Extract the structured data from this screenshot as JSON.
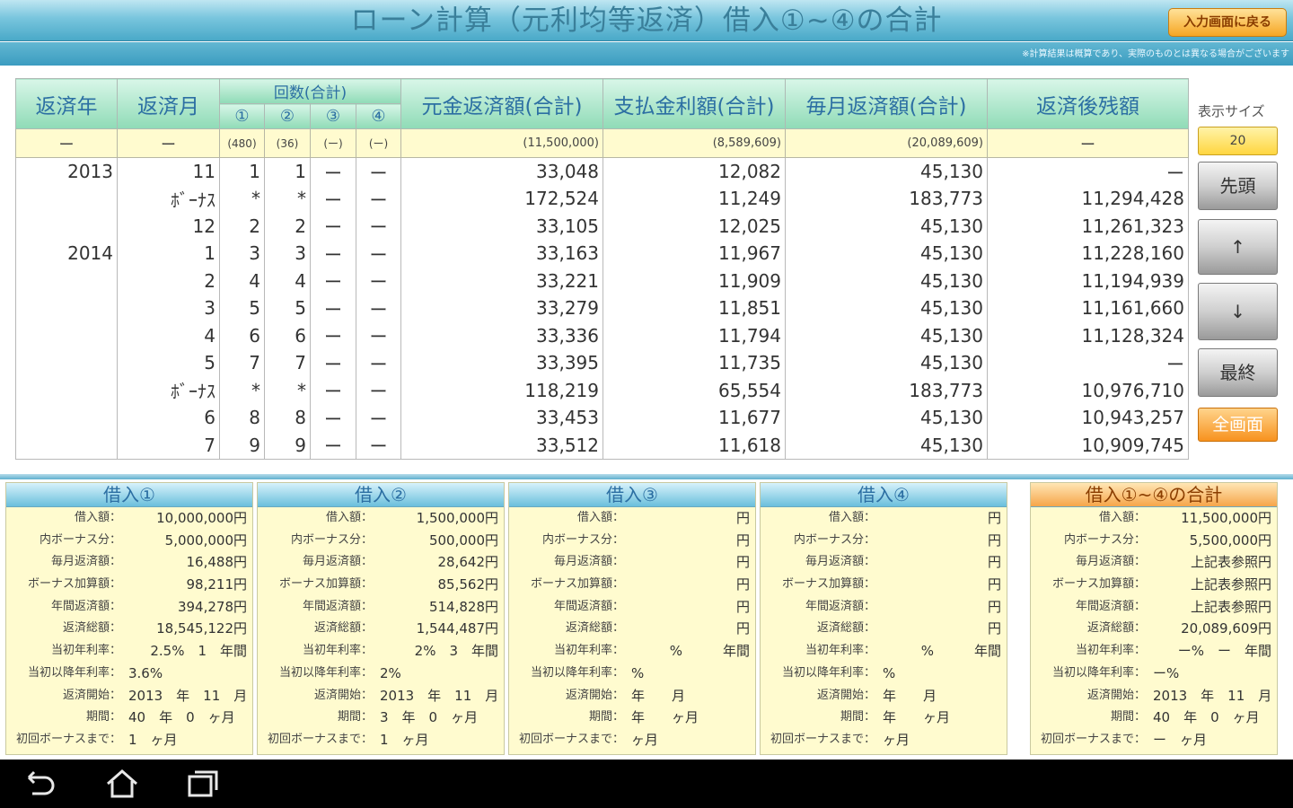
{
  "title": "ローン計算（元利均等返済）借入①~④の合計",
  "back_button": "入力画面に戻る",
  "note": "※計算結果は概算であり、実際のものとは異なる場合がございます",
  "table": {
    "headers": {
      "year": "返済年",
      "month": "返済月",
      "count": "回数(合計)",
      "count_sub": [
        "①",
        "②",
        "③",
        "④"
      ],
      "principal": "元金返済額(合計)",
      "interest": "支払金利額(合計)",
      "monthly": "毎月返済額(合計)",
      "balance": "返済後残額"
    },
    "totals": {
      "year": "ー",
      "month": "ー",
      "c1": "(480)",
      "c2": "(36)",
      "c3": "(ー)",
      "c4": "(ー)",
      "principal": "(11,500,000)",
      "interest": "(8,589,609)",
      "monthly": "(20,089,609)",
      "balance": "ー"
    },
    "rows": [
      {
        "year": "2013",
        "month": "11",
        "c1": "1",
        "c2": "1",
        "c3": "ー",
        "c4": "ー",
        "principal": "33,048",
        "interest": "12,082",
        "monthly": "45,130",
        "balance": "ー"
      },
      {
        "year": "",
        "month": "ﾎﾞｰﾅｽ",
        "c1": "*",
        "c2": "*",
        "c3": "ー",
        "c4": "ー",
        "principal": "172,524",
        "interest": "11,249",
        "monthly": "183,773",
        "balance": "11,294,428"
      },
      {
        "year": "",
        "month": "12",
        "c1": "2",
        "c2": "2",
        "c3": "ー",
        "c4": "ー",
        "principal": "33,105",
        "interest": "12,025",
        "monthly": "45,130",
        "balance": "11,261,323"
      },
      {
        "year": "2014",
        "month": "1",
        "c1": "3",
        "c2": "3",
        "c3": "ー",
        "c4": "ー",
        "principal": "33,163",
        "interest": "11,967",
        "monthly": "45,130",
        "balance": "11,228,160"
      },
      {
        "year": "",
        "month": "2",
        "c1": "4",
        "c2": "4",
        "c3": "ー",
        "c4": "ー",
        "principal": "33,221",
        "interest": "11,909",
        "monthly": "45,130",
        "balance": "11,194,939"
      },
      {
        "year": "",
        "month": "3",
        "c1": "5",
        "c2": "5",
        "c3": "ー",
        "c4": "ー",
        "principal": "33,279",
        "interest": "11,851",
        "monthly": "45,130",
        "balance": "11,161,660"
      },
      {
        "year": "",
        "month": "4",
        "c1": "6",
        "c2": "6",
        "c3": "ー",
        "c4": "ー",
        "principal": "33,336",
        "interest": "11,794",
        "monthly": "45,130",
        "balance": "11,128,324"
      },
      {
        "year": "",
        "month": "5",
        "c1": "7",
        "c2": "7",
        "c3": "ー",
        "c4": "ー",
        "principal": "33,395",
        "interest": "11,735",
        "monthly": "45,130",
        "balance": "ー"
      },
      {
        "year": "",
        "month": "ﾎﾞｰﾅｽ",
        "c1": "*",
        "c2": "*",
        "c3": "ー",
        "c4": "ー",
        "principal": "118,219",
        "interest": "65,554",
        "monthly": "183,773",
        "balance": "10,976,710"
      },
      {
        "year": "",
        "month": "6",
        "c1": "8",
        "c2": "8",
        "c3": "ー",
        "c4": "ー",
        "principal": "33,453",
        "interest": "11,677",
        "monthly": "45,130",
        "balance": "10,943,257"
      },
      {
        "year": "",
        "month": "7",
        "c1": "9",
        "c2": "9",
        "c3": "ー",
        "c4": "ー",
        "principal": "33,512",
        "interest": "11,618",
        "monthly": "45,130",
        "balance": "10,909,745"
      }
    ]
  },
  "controls": {
    "size_label": "表示サイズ",
    "size_value": "20",
    "first": "先頭",
    "up": "↑",
    "down": "↓",
    "last": "最終",
    "fullscreen": "全画面"
  },
  "panels": [
    {
      "title": "借入①",
      "rows": [
        {
          "label": "借入額：",
          "value": "10,000,000円"
        },
        {
          "label": "内ボーナス分：",
          "value": "5,000,000円"
        },
        {
          "label": "毎月返済額：",
          "value": "16,488円"
        },
        {
          "label": "ボーナス加算額：",
          "value": "98,211円"
        },
        {
          "label": "年間返済額：",
          "value": "394,278円"
        },
        {
          "label": "返済総額：",
          "value": "18,545,122円"
        },
        {
          "label": "当初年利率：",
          "value": "2.5%　1　年間"
        },
        {
          "label": "当初以降年利率：",
          "value": "3.6%"
        },
        {
          "label": "返済開始：",
          "value": "2013　年　11　月"
        },
        {
          "label": "期間：",
          "value": "40　年　0　ヶ月"
        },
        {
          "label": "初回ボーナスまで：",
          "value": "1　ヶ月"
        }
      ]
    },
    {
      "title": "借入②",
      "rows": [
        {
          "label": "借入額：",
          "value": "1,500,000円"
        },
        {
          "label": "内ボーナス分：",
          "value": "500,000円"
        },
        {
          "label": "毎月返済額：",
          "value": "28,642円"
        },
        {
          "label": "ボーナス加算額：",
          "value": "85,562円"
        },
        {
          "label": "年間返済額：",
          "value": "514,828円"
        },
        {
          "label": "返済総額：",
          "value": "1,544,487円"
        },
        {
          "label": "当初年利率：",
          "value": "2%　3　年間"
        },
        {
          "label": "当初以降年利率：",
          "value": "2%"
        },
        {
          "label": "返済開始：",
          "value": "2013　年　11　月"
        },
        {
          "label": "期間：",
          "value": "3　年　0　ヶ月"
        },
        {
          "label": "初回ボーナスまで：",
          "value": "1　ヶ月"
        }
      ]
    },
    {
      "title": "借入③",
      "rows": [
        {
          "label": "借入額：",
          "value": "円"
        },
        {
          "label": "内ボーナス分：",
          "value": "円"
        },
        {
          "label": "毎月返済額：",
          "value": "円"
        },
        {
          "label": "ボーナス加算額：",
          "value": "円"
        },
        {
          "label": "年間返済額：",
          "value": "円"
        },
        {
          "label": "返済総額：",
          "value": "円"
        },
        {
          "label": "当初年利率：",
          "value": "%　　　年間"
        },
        {
          "label": "当初以降年利率：",
          "value": "%"
        },
        {
          "label": "返済開始：",
          "value": "年　　月"
        },
        {
          "label": "期間：",
          "value": "年　　ヶ月"
        },
        {
          "label": "初回ボーナスまで：",
          "value": "ヶ月"
        }
      ]
    },
    {
      "title": "借入④",
      "rows": [
        {
          "label": "借入額：",
          "value": "円"
        },
        {
          "label": "内ボーナス分：",
          "value": "円"
        },
        {
          "label": "毎月返済額：",
          "value": "円"
        },
        {
          "label": "ボーナス加算額：",
          "value": "円"
        },
        {
          "label": "年間返済額：",
          "value": "円"
        },
        {
          "label": "返済総額：",
          "value": "円"
        },
        {
          "label": "当初年利率：",
          "value": "%　　　年間"
        },
        {
          "label": "当初以降年利率：",
          "value": "%"
        },
        {
          "label": "返済開始：",
          "value": "年　　月"
        },
        {
          "label": "期間：",
          "value": "年　　ヶ月"
        },
        {
          "label": "初回ボーナスまで：",
          "value": "ヶ月"
        }
      ]
    },
    {
      "title": "借入①~④の合計",
      "rows": [
        {
          "label": "借入額：",
          "value": "11,500,000円"
        },
        {
          "label": "内ボーナス分：",
          "value": "5,500,000円"
        },
        {
          "label": "毎月返済額：",
          "value": "上記表参照円"
        },
        {
          "label": "ボーナス加算額：",
          "value": "上記表参照円"
        },
        {
          "label": "年間返済額：",
          "value": "上記表参照円"
        },
        {
          "label": "返済総額：",
          "value": "20,089,609円"
        },
        {
          "label": "当初年利率：",
          "value": "ー%　ー　年間"
        },
        {
          "label": "当初以降年利率：",
          "value": "ー%"
        },
        {
          "label": "返済開始：",
          "value": "2013　年　11　月"
        },
        {
          "label": "期間：",
          "value": "40　年　0　ヶ月"
        },
        {
          "label": "初回ボーナスまで：",
          "value": "ー　ヶ月"
        }
      ]
    }
  ],
  "navbar": {
    "icons": [
      "back-icon",
      "home-icon",
      "recent-apps-icon"
    ]
  }
}
